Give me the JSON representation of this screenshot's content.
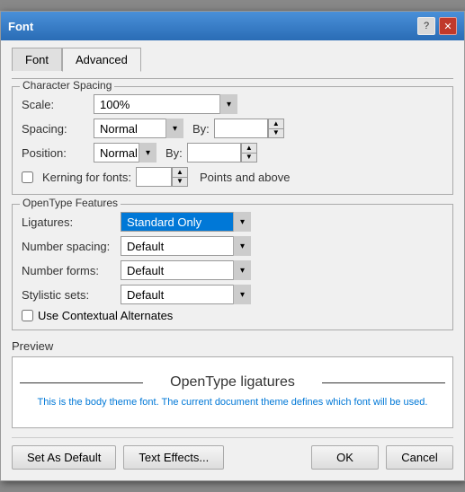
{
  "titleBar": {
    "title": "Font",
    "helpBtn": "?",
    "closeBtn": "✕"
  },
  "tabs": [
    {
      "id": "font",
      "label": "Font",
      "active": false
    },
    {
      "id": "advanced",
      "label": "Advanced",
      "active": true
    }
  ],
  "characterSpacing": {
    "sectionLabel": "Character Spacing",
    "scaleLabel": "Scale:",
    "scaleValue": "100%",
    "spacingLabel": "Spacing:",
    "spacingValue": "Normal",
    "positionLabel": "Position:",
    "positionValue": "Normal",
    "byLabel1": "By:",
    "byLabel2": "By:",
    "kerningLabel": "Kerning for fonts:",
    "kerningChecked": false,
    "pointsText": "Points and above"
  },
  "openTypeFeatures": {
    "sectionLabel": "OpenType Features",
    "ligaturesLabel": "Ligatures:",
    "ligaturesValue": "Standard Only",
    "numberSpacingLabel": "Number spacing:",
    "numberSpacingValue": "Default",
    "numberFormsLabel": "Number forms:",
    "numberFormsValue": "Default",
    "stylisticSetsLabel": "Stylistic sets:",
    "stylisticSetsValue": "Default",
    "contextualLabel": "Use Contextual Alternates",
    "contextualChecked": false
  },
  "preview": {
    "sectionLabel": "Preview",
    "previewText": "OpenType ligatures",
    "descText": "This is the body theme font. The current document theme defines which font will be used."
  },
  "buttons": {
    "setAsDefault": "Set As Default",
    "textEffects": "Text Effects...",
    "ok": "OK",
    "cancel": "Cancel"
  }
}
